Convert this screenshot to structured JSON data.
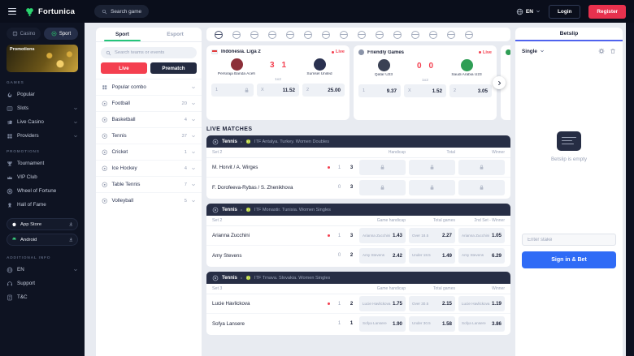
{
  "header": {
    "brand": "Fortunica",
    "search_button": "Search game",
    "language": "EN",
    "login": "Login",
    "register": "Register"
  },
  "sidebar": {
    "casino": "Casino",
    "sport": "Sport",
    "promotions_banner": "Promotions",
    "sections": {
      "games": "GAMES",
      "promotions": "PROMOTIONS",
      "additional": "ADDITIONAL INFO"
    },
    "games": [
      "Popular",
      "Slots",
      "Live Casino",
      "Providers"
    ],
    "promo_links": [
      "Tournament",
      "VIP Club",
      "Wheel of Fortune",
      "Hall of Fame"
    ],
    "apps": [
      "App Store",
      "Android"
    ],
    "additional": [
      "EN",
      "Support",
      "T&C"
    ]
  },
  "filters": {
    "tab_sport": "Sport",
    "tab_esport": "Esport",
    "search_placeholder": "Search teams or events",
    "live": "Live",
    "prematch": "Prematch",
    "sports": [
      {
        "name": "Popular combo",
        "count": ""
      },
      {
        "name": "Football",
        "count": "20"
      },
      {
        "name": "Basketball",
        "count": "4"
      },
      {
        "name": "Tennis",
        "count": "37"
      },
      {
        "name": "Cricket",
        "count": "1"
      },
      {
        "name": "Ice Hockey",
        "count": "4"
      },
      {
        "name": "Table Tennis",
        "count": "7"
      },
      {
        "name": "Volleyball",
        "count": "5"
      }
    ]
  },
  "cards": [
    {
      "league": "Indonesia. Liga 2",
      "live": "Live",
      "home": "Persiraja Banda Aceh",
      "away": "Sumsel United",
      "score_home": "3",
      "score_away": "1",
      "market": "1x2",
      "odds": [
        {
          "label": "1",
          "value": ""
        },
        {
          "label": "X",
          "value": "11.52"
        },
        {
          "label": "2",
          "value": "25.00"
        }
      ]
    },
    {
      "league": "Friendly Games",
      "live": "Live",
      "home": "Qatar U23",
      "away": "Saudi Arabia U23",
      "score_home": "0",
      "score_away": "0",
      "market": "1x2",
      "odds": [
        {
          "label": "1",
          "value": "9.37"
        },
        {
          "label": "X",
          "value": "1.52"
        },
        {
          "label": "2",
          "value": "3.05"
        }
      ]
    }
  ],
  "live_matches_title": "LIVE MATCHES",
  "matches": [
    {
      "sport": "Tennis",
      "league": "ITF Antalya. Turkey. Women Doubles",
      "set": "Set 2",
      "markets": [
        "Handicap",
        "Total",
        "Winner"
      ],
      "rows": [
        {
          "name": "M. Horvit / A. Wirges",
          "s1": "1",
          "s2": "3"
        },
        {
          "name": "F. Dorofeeva-Rybas / S. Zhenikhova",
          "s1": "0",
          "s2": "3"
        }
      ]
    },
    {
      "sport": "Tennis",
      "league": "ITF Monastir. Tunisia. Women Singles",
      "set": "Set 2",
      "markets": [
        "Game handicap",
        "Total games",
        "2nd Set - Winner"
      ],
      "rows": [
        {
          "name": "Arianna Zucchini",
          "s1": "1",
          "s2": "3",
          "cells": [
            {
              "label": "Arianna Zucchini",
              "value": "1.43"
            },
            {
              "label": "Over 18.5",
              "value": "2.27"
            },
            {
              "label": "Arianna Zucchini",
              "value": "1.05"
            }
          ]
        },
        {
          "name": "Amy Stevens",
          "s1": "0",
          "s2": "2",
          "cells": [
            {
              "label": "Amy Stevens",
              "value": "2.42"
            },
            {
              "label": "Under 18.5",
              "value": "1.49"
            },
            {
              "label": "Amy Stevens",
              "value": "6.29"
            }
          ]
        }
      ]
    },
    {
      "sport": "Tennis",
      "league": "ITF Trnava. Slovakia. Women Singles",
      "set": "Set 3",
      "markets": [
        "Game handicap",
        "Total games",
        "Winner"
      ],
      "rows": [
        {
          "name": "Lucie Havlickova",
          "s1": "1",
          "s2": "2",
          "cells": [
            {
              "label": "Lucie Havlickova",
              "value": "1.75"
            },
            {
              "label": "Over 30.5",
              "value": "2.15"
            },
            {
              "label": "Lucie Havlickova",
              "value": "1.19"
            }
          ]
        },
        {
          "name": "Sofya Lansere",
          "s1": "1",
          "s2": "1",
          "cells": [
            {
              "label": "Sofya Lansere",
              "value": "1.90"
            },
            {
              "label": "Under 30.5",
              "value": "1.58"
            },
            {
              "label": "Sofya Lansere",
              "value": "3.86"
            }
          ]
        }
      ]
    }
  ],
  "betslip": {
    "tab": "Betslip",
    "mode": "Single",
    "empty": "Betslip is empty",
    "stake_placeholder": "Enter stake",
    "cta": "Sign in & Bet"
  },
  "colors": {
    "accent_green": "#2bd46f",
    "live_red": "#f43f4f",
    "cta_blue": "#2f6bf6",
    "register_red": "#e8314e",
    "betslip_underline": "#4f63ee"
  },
  "icon_glyphs": {
    "menu": "hamburger-bars",
    "search": "svg-magnifier",
    "globe": "svg-globe",
    "chevron-down": "svg-chevron",
    "lock": "svg-padlock",
    "gear": "svg-gear",
    "trash": "svg-trash",
    "flame": "svg-flame",
    "download": "svg-arrow-tray"
  }
}
